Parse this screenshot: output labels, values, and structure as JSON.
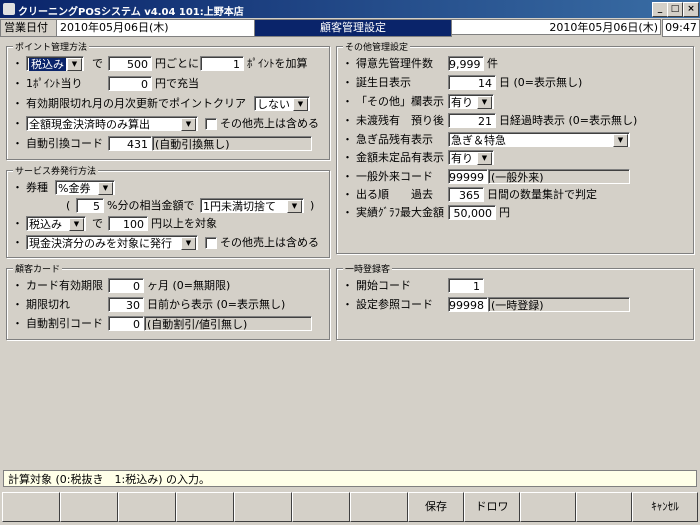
{
  "window": {
    "title": "クリーニングPOSシステム v4.04 101:上野本店",
    "min": "_",
    "max": "□",
    "close": "×"
  },
  "header": {
    "date_label": "営業日付",
    "date_value": "2010年05月06日(木)",
    "title": "顧客管理設定",
    "right_date": "2010年05月06日(木)",
    "time": "09:47"
  },
  "points": {
    "group_title": "ポイント管理方法",
    "tax_option": "税込み",
    "de": "で",
    "amount": "500",
    "per": "円ごとに",
    "points": "1",
    "add": "ﾎﾟｲﾝﾄを加算",
    "per_point": "1ﾎﾟｲﾝﾄ当り",
    "point_value": "0",
    "charge": "円で充当",
    "clear_label": "有効期限切れ月の月次更新でポイントクリア",
    "clear_value": "しない",
    "calc_method": "全額現金決済時のみ算出",
    "other_sales": "その他売上は含める",
    "auto_code_label": "自動引換コード",
    "auto_code": "431",
    "auto_code_desc": "(自動引換無し)"
  },
  "coupon": {
    "group_title": "サービス券発行方法",
    "type_label": "券種",
    "type_value": "%金券",
    "open_paren": "(",
    "percent": "5",
    "percent_text": "%分の相当金額で",
    "rounding": "1円未満切捨て",
    "close_paren": ")",
    "tax_option": "税込み",
    "de": "で",
    "min_amount": "100",
    "min_text": "円以上を対象",
    "target": "現金決済分のみを対象に発行",
    "other_sales": "その他売上は含める"
  },
  "card": {
    "group_title": "顧客カード",
    "expiry_label": "カード有効期限",
    "expiry_value": "0",
    "expiry_unit": "ヶ月 (0=無期限)",
    "expired_label": "期限切れ",
    "expired_value": "30",
    "expired_unit": "日前から表示 (0=表示無し)",
    "discount_label": "自動割引コード",
    "discount_value": "0",
    "discount_desc": "(自動割引/値引無し)"
  },
  "other": {
    "group_title": "その他管理設定",
    "customer_count_label": "得意先管理件数",
    "customer_count": "9,999",
    "customer_count_unit": "件",
    "birthday_label": "誕生日表示",
    "birthday_value": "14",
    "birthday_unit": "日 (0=表示無し)",
    "other_col_label": "「その他」欄表示",
    "other_col_value": "有り",
    "unpaid_label": "未渡残有　預り後",
    "unpaid_value": "21",
    "unpaid_unit": "日経過時表示 (0=表示無し)",
    "urgent_label": "急ぎ品残有表示",
    "urgent_value": "急ぎ＆特急",
    "unfixed_label": "金額未定品有表示",
    "unfixed_value": "有り",
    "general_code_label": "一般外来コード",
    "general_code": "99999",
    "general_code_desc": "(一般外来)",
    "order_label": "出る順　　過去",
    "order_value": "365",
    "order_unit": "日間の数量集計で判定",
    "graph_label": "実績ｸﾞﾗﾌ最大金額",
    "graph_value": "50,000",
    "graph_unit": "円"
  },
  "temp": {
    "group_title": "一時登録客",
    "start_label": "開始コード",
    "start_value": "1",
    "ref_label": "設定参照コード",
    "ref_value": "99998",
    "ref_desc": "(一時登録)"
  },
  "bullet": "・",
  "status_text": "計算対象 (0:税抜き　1:税込み) の入力。",
  "footer": {
    "save": "保存",
    "draw": "ドロワ",
    "cancel": "ｷｬﾝｾﾙ"
  }
}
